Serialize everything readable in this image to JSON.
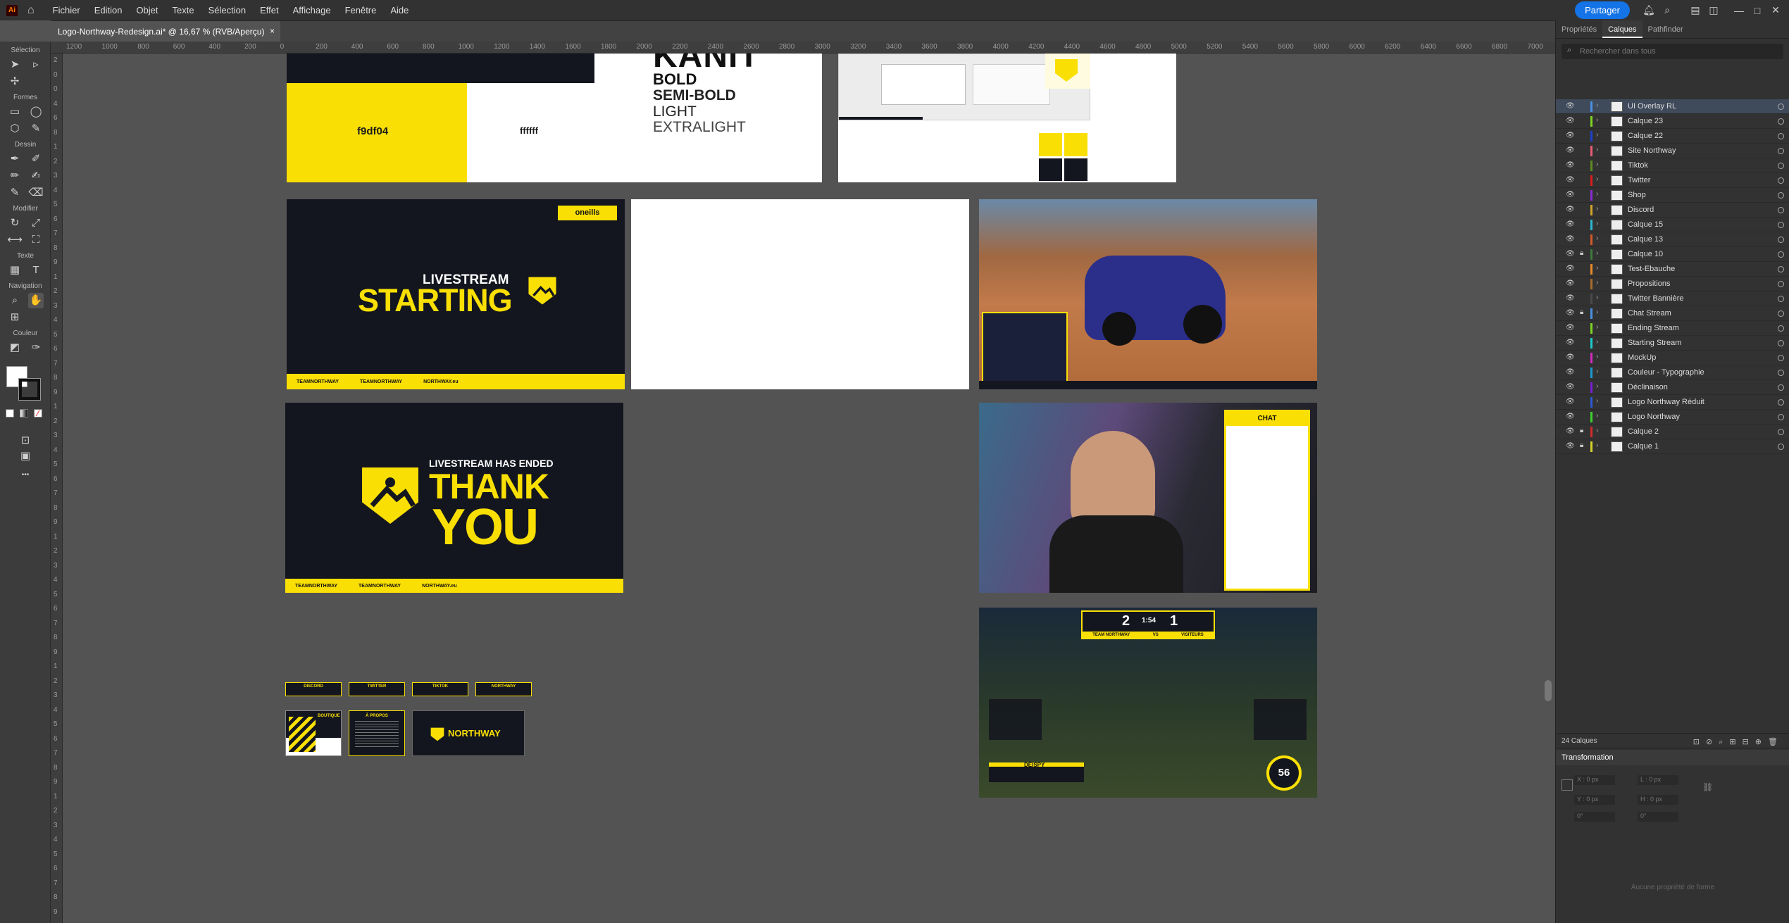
{
  "app": {
    "logo": "Ai",
    "menu": [
      "Fichier",
      "Edition",
      "Objet",
      "Texte",
      "Sélection",
      "Effet",
      "Affichage",
      "Fenêtre",
      "Aide"
    ],
    "share_label": "Partager"
  },
  "document_tab": {
    "title": "Logo-Northway-Redesign.ai* @ 16,67 % (RVB/Aperçu)",
    "close": "×"
  },
  "toolbar": {
    "sections": [
      "Sélection",
      "Formes",
      "Dessin",
      "Modifier",
      "Texte",
      "Navigation",
      "Couleur"
    ],
    "more": "•••"
  },
  "rulers": {
    "top": [
      "1200",
      "1000",
      "800",
      "600",
      "400",
      "200",
      "0",
      "200",
      "400",
      "600",
      "800",
      "1000",
      "1200",
      "1400",
      "1600",
      "1800",
      "2000",
      "2200",
      "2400",
      "2600",
      "2800",
      "3000",
      "3200",
      "3400",
      "3600",
      "3800",
      "4000",
      "4200",
      "4400",
      "4600",
      "4800",
      "5000",
      "5200",
      "5400",
      "5600",
      "5800",
      "6000",
      "6200",
      "6400",
      "6600",
      "6800",
      "7000"
    ],
    "left": [
      "2",
      "0",
      "0",
      "4",
      "6",
      "8",
      "1",
      "2",
      "3",
      "4",
      "5",
      "6",
      "7",
      "8",
      "9",
      "1",
      "2",
      "3",
      "4",
      "5",
      "6",
      "7",
      "8",
      "9",
      "1",
      "2",
      "3",
      "4",
      "5",
      "6",
      "7",
      "8",
      "9",
      "1",
      "2",
      "3",
      "4",
      "5",
      "6",
      "7",
      "8",
      "9",
      "1",
      "2",
      "3",
      "4",
      "5",
      "6",
      "7",
      "8",
      "9",
      "1",
      "2",
      "3",
      "4",
      "5",
      "6",
      "7",
      "8",
      "9"
    ]
  },
  "artboards": {
    "typography": {
      "font_big": "KANIT",
      "weights": [
        "BOLD",
        "SEMI-BOLD",
        "LIGHT",
        "EXTRALIGHT"
      ],
      "swatch1": "f9df04",
      "swatch2": "ffffff"
    },
    "starting": {
      "tag": "oneills",
      "line1": "LIVESTREAM",
      "line2": "STARTING",
      "socials": [
        "TEAMNORTHWAY",
        "TEAMNORTHWAY",
        "NORTHWAY.eu"
      ]
    },
    "ended": {
      "line1": "LIVESTREAM HAS ENDED",
      "line2": "THANK",
      "line3": "YOU",
      "socials": [
        "TEAMNORTHWAY",
        "TEAMNORTHWAY",
        "NORTHWAY.eu"
      ]
    },
    "chat": {
      "label": "CHAT"
    },
    "scoreboard": {
      "score_home": "2",
      "score_away": "1",
      "clock": "1:54",
      "team_home": "TEAM NORTHWAY",
      "vs": "VS",
      "team_away": "VISITEURS",
      "boost": "56",
      "player": "DEISPY"
    },
    "panels": [
      "DISCORD",
      "TWITTER",
      "TIKTOK",
      "NORTHWAY"
    ],
    "blocks": [
      "BOUTIQUE",
      "À PROPOS",
      "NORTHWAY"
    ]
  },
  "right_panel": {
    "tabs": [
      "Propriétés",
      "Calques",
      "Pathfinder"
    ],
    "search_placeholder": "Rechercher dans tous",
    "layers": [
      {
        "name": "UI Overlay RL",
        "color": "#4a90e2",
        "locked": false,
        "selected": true
      },
      {
        "name": "Calque 23",
        "color": "#7dd321",
        "locked": false
      },
      {
        "name": "Calque 22",
        "color": "#1d40c9",
        "locked": false
      },
      {
        "name": "Site Northway",
        "color": "#e85d75",
        "locked": false
      },
      {
        "name": "Tiktok",
        "color": "#5c8a1f",
        "locked": false
      },
      {
        "name": "Twitter",
        "color": "#d81d1d",
        "locked": false
      },
      {
        "name": "Shop",
        "color": "#8b2bd1",
        "locked": false
      },
      {
        "name": "Discord",
        "color": "#d1a52b",
        "locked": false
      },
      {
        "name": "Calque 15",
        "color": "#2bb8d1",
        "locked": false
      },
      {
        "name": "Calque 13",
        "color": "#d15a2b",
        "locked": false
      },
      {
        "name": "Calque 10",
        "color": "#3d7a3d",
        "locked": true
      },
      {
        "name": "Test-Ebauche",
        "color": "#e88a2b",
        "locked": false
      },
      {
        "name": "Propositions",
        "color": "#a86b2b",
        "locked": false
      },
      {
        "name": "Twitter Bannière",
        "color": "#4a4a4a",
        "locked": false
      },
      {
        "name": "Chat Stream",
        "color": "#4a90e2",
        "locked": true
      },
      {
        "name": "Ending Stream",
        "color": "#7dd321",
        "locked": false
      },
      {
        "name": "Starting Stream",
        "color": "#1dc9c9",
        "locked": false
      },
      {
        "name": "MockUp",
        "color": "#d12bbd",
        "locked": false
      },
      {
        "name": "Couleur - Typographie",
        "color": "#1d9ad1",
        "locked": false
      },
      {
        "name": "Déclinaison",
        "color": "#7a1dd1",
        "locked": false
      },
      {
        "name": "Logo Northway Réduit",
        "color": "#2b5ad1",
        "locked": false
      },
      {
        "name": "Logo Northway",
        "color": "#3dd12b",
        "locked": false
      },
      {
        "name": "Calque 2",
        "color": "#d12b2b",
        "locked": true
      },
      {
        "name": "Calque 1",
        "color": "#d1d12b",
        "locked": true
      }
    ],
    "layer_count": "24 Calques",
    "transform_title": "Transformation",
    "fields": [
      "X : 0 px",
      "L : 0 px",
      "Y : 0 px",
      "H : 0 px",
      "0°",
      "0°"
    ],
    "no_prop": "Aucune propriété de forme"
  }
}
